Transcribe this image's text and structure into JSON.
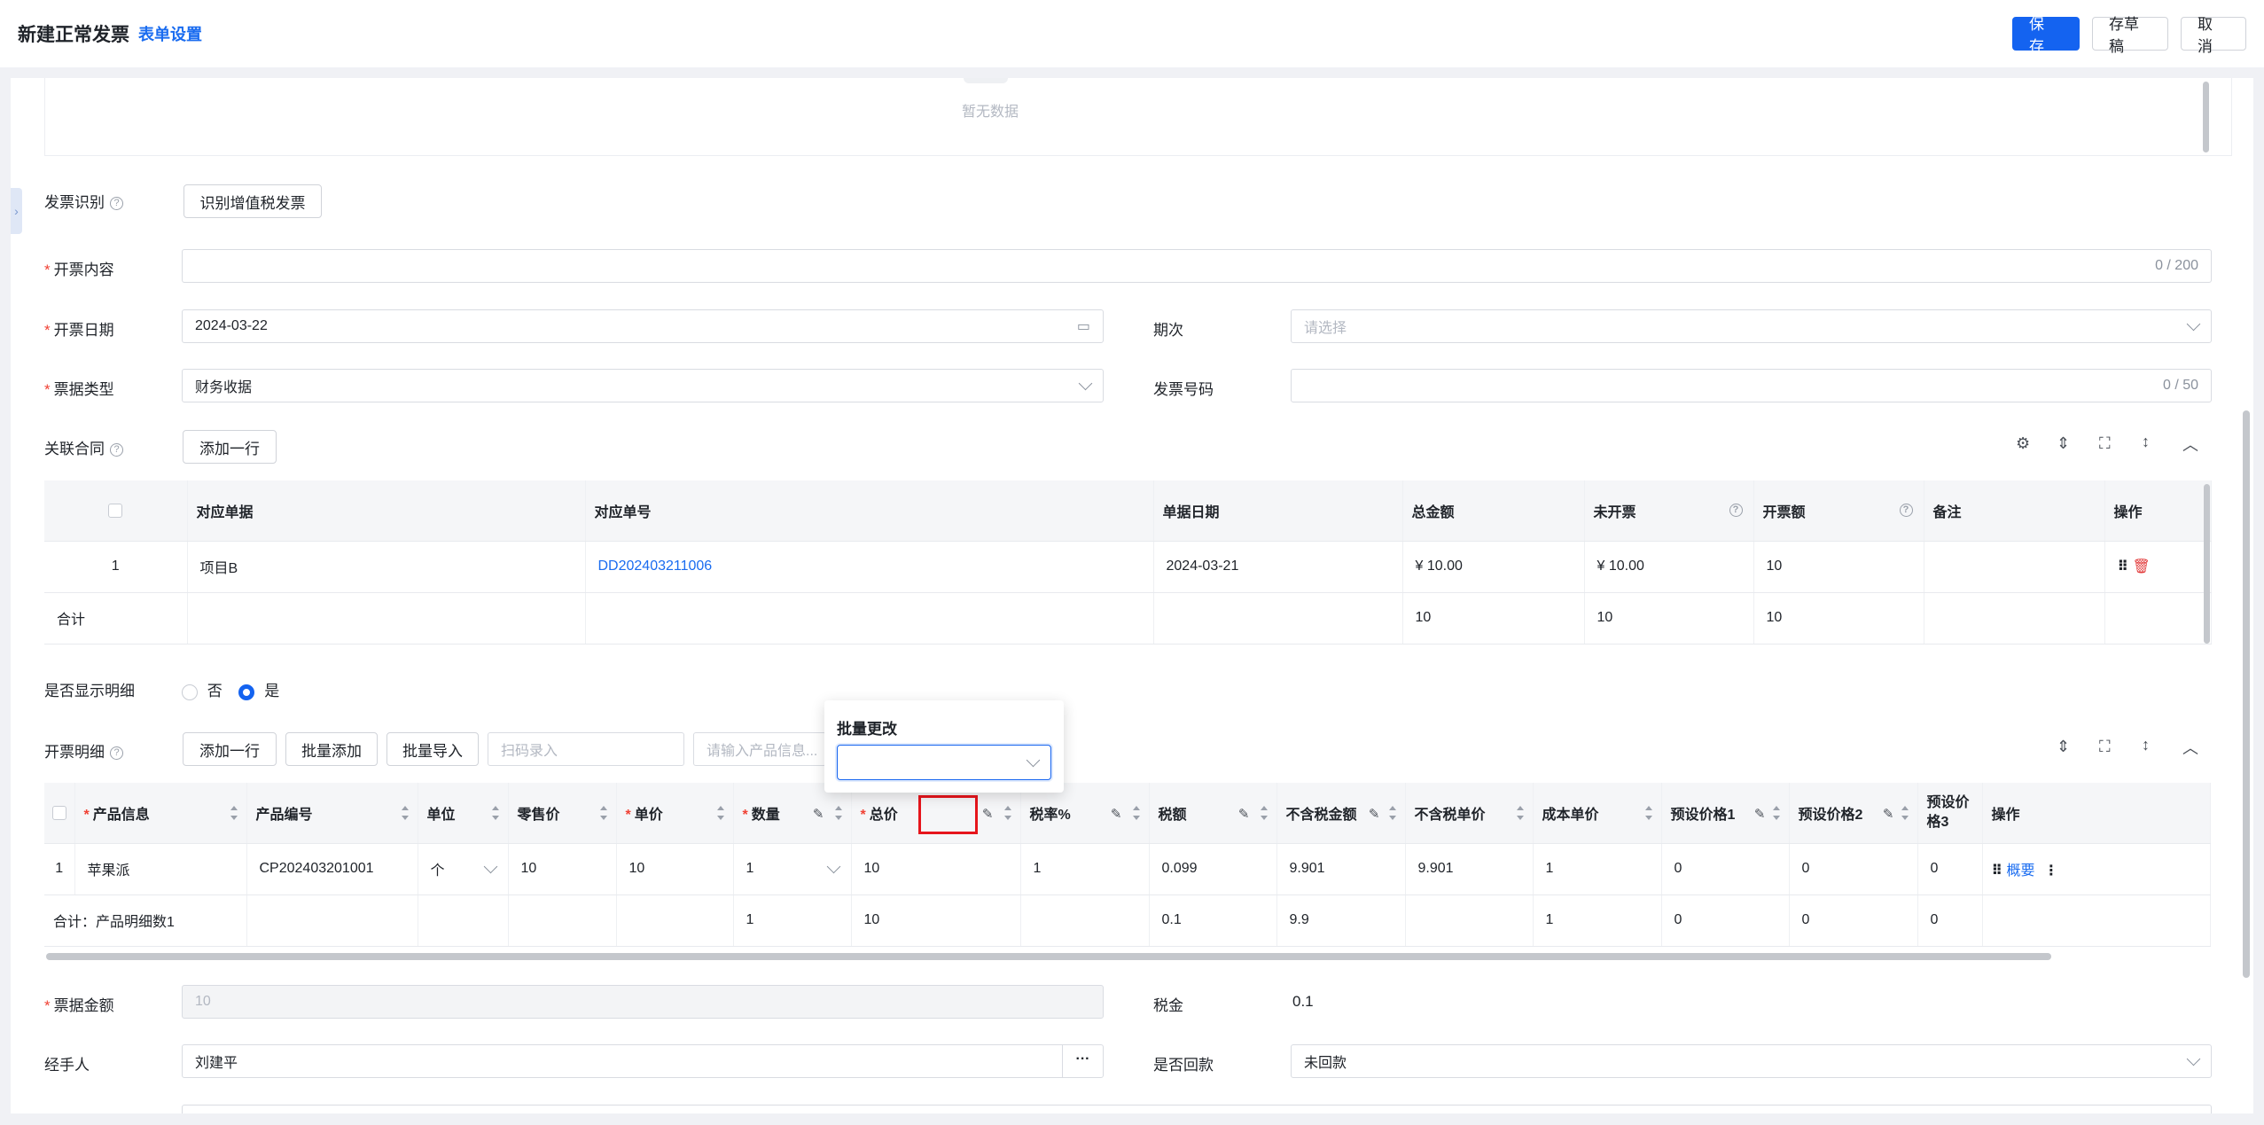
{
  "header": {
    "title": "新建正常发票",
    "form_settings": "表单设置",
    "save": "保 存",
    "draft": "存草稿",
    "cancel": "取 消"
  },
  "empty_text": "暂无数据",
  "invoice_ident": {
    "label": "发票识别",
    "button": "识别增值税发票"
  },
  "content": {
    "label": "开票内容",
    "counter": "0 / 200"
  },
  "date": {
    "label": "开票日期",
    "value": "2024-03-22"
  },
  "period": {
    "label": "期次",
    "placeholder": "请选择"
  },
  "bill_type": {
    "label": "票据类型",
    "value": "财务收据"
  },
  "invoice_no": {
    "label": "发票号码",
    "counter": "0 / 50"
  },
  "contract": {
    "label": "关联合同",
    "add_row": "添加一行",
    "columns": [
      "对应单据",
      "对应单号",
      "单据日期",
      "总金额",
      "未开票",
      "开票额",
      "备注",
      "操作"
    ],
    "rows": [
      {
        "index": "1",
        "doc": "项目B",
        "doc_no": "DD202403211006",
        "date": "2024-03-21",
        "total": "¥ 10.00",
        "uninvoiced": "¥ 10.00",
        "invoiced": "10",
        "note": ""
      }
    ],
    "summary": {
      "label": "合计",
      "total": "10",
      "uninvoiced": "10",
      "invoiced": "10"
    }
  },
  "show_detail": {
    "label": "是否显示明细",
    "no": "否",
    "yes": "是"
  },
  "detail": {
    "label": "开票明细",
    "add_row": "添加一行",
    "batch_add": "批量添加",
    "batch_import": "批量导入",
    "scan_placeholder": "扫码录入",
    "product_placeholder": "请输入产品信息...",
    "columns": [
      "产品信息",
      "产品编号",
      "单位",
      "零售价",
      "单价",
      "数量",
      "总价",
      "税率%",
      "税额",
      "不含税金额",
      "不含税单价",
      "成本单价",
      "预设价格1",
      "预设价格2",
      "预设价格3",
      "操作"
    ],
    "rows": [
      {
        "index": "1",
        "product": "苹果派",
        "code": "CP202403201001",
        "unit": "个",
        "retail": "10",
        "price": "10",
        "qty": "1",
        "total": "10",
        "tax_rate": "1",
        "tax": "0.099",
        "ex_tax_amount": "9.901",
        "ex_tax_price": "9.901",
        "cost": "1",
        "p1": "0",
        "p2": "0",
        "p3": "0",
        "op_link": "概要"
      }
    ],
    "summary": {
      "label": "合计：产品明细数1",
      "qty": "1",
      "total": "10",
      "tax": "0.1",
      "ex_tax_amount": "9.9",
      "cost": "1",
      "p1": "0",
      "p2": "0",
      "p3": "0"
    }
  },
  "batch_popover": {
    "title": "批量更改"
  },
  "bill_amount": {
    "label": "票据金额",
    "value": "10"
  },
  "tax": {
    "label": "税金",
    "value": "0.1"
  },
  "handler": {
    "label": "经手人",
    "value": "刘建平"
  },
  "paid_back": {
    "label": "是否回款",
    "value": "未回款"
  }
}
